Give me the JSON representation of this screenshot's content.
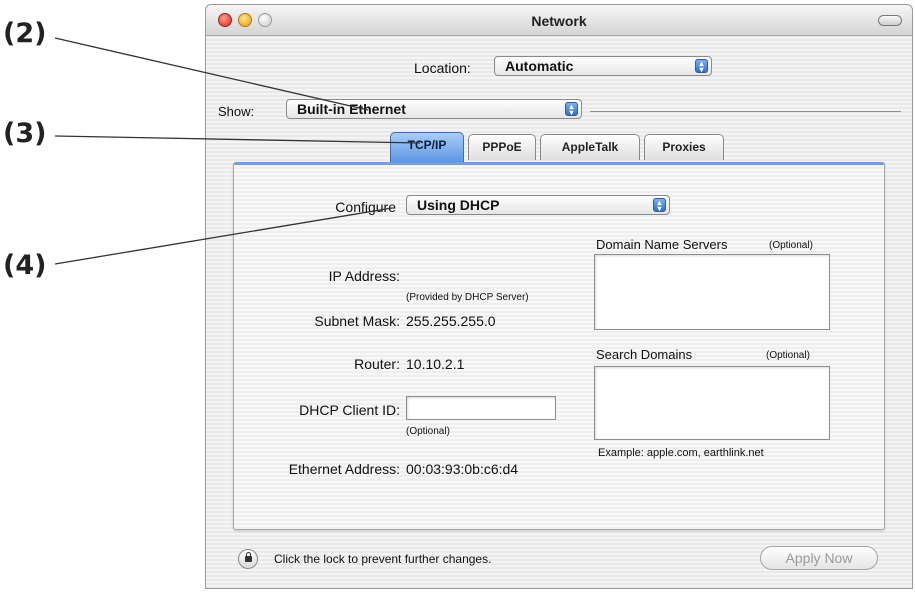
{
  "callouts": {
    "c2": "(2)",
    "c3": "(3)",
    "c4": "(4)"
  },
  "window": {
    "title": "Network"
  },
  "location": {
    "label": "Location:",
    "value": "Automatic"
  },
  "show": {
    "label": "Show:",
    "value": "Built-in Ethernet"
  },
  "tabs": [
    {
      "label": "TCP/IP",
      "active": true
    },
    {
      "label": "PPPoE",
      "active": false
    },
    {
      "label": "AppleTalk",
      "active": false
    },
    {
      "label": "Proxies",
      "active": false
    }
  ],
  "configure": {
    "label": "Configure",
    "value": "Using DHCP"
  },
  "fields": {
    "ip_label": "IP Address:",
    "ip_note": "(Provided by DHCP Server)",
    "subnet_label": "Subnet Mask:",
    "subnet_value": "255.255.255.0",
    "router_label": "Router:",
    "router_value": "10.10.2.1",
    "dhcp_label": "DHCP Client ID:",
    "dhcp_value": "",
    "dhcp_note": "(Optional)",
    "ethernet_label": "Ethernet Address:",
    "ethernet_value": "00:03:93:0b:c6:d4"
  },
  "dns": {
    "label": "Domain Name Servers",
    "optional": "(Optional)",
    "value": ""
  },
  "search": {
    "label": "Search Domains",
    "optional": "(Optional)",
    "value": "",
    "example": "Example: apple.com, earthlink.net"
  },
  "footer": {
    "lock_text": "Click the lock to prevent further changes.",
    "apply_label": "Apply Now"
  },
  "colors": {
    "accent": "#5d97e3",
    "close": "#d0281a",
    "minimize": "#e3a00f"
  }
}
